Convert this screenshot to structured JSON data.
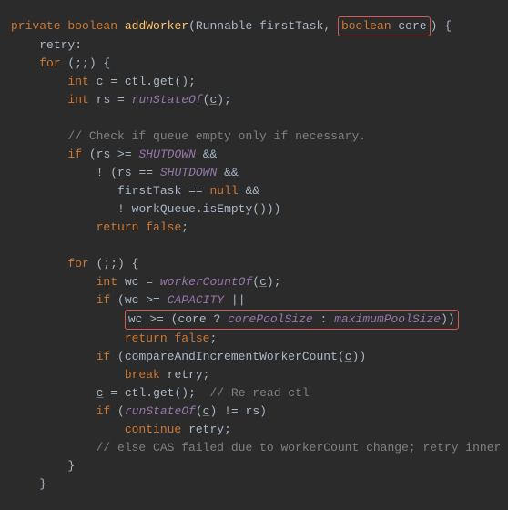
{
  "sig": {
    "private": "private",
    "boolean": "boolean",
    "name": "addWorker",
    "p1_type": "Runnable",
    "p1_name": "firstTask",
    "p2_type": "boolean",
    "p2_name": "core",
    "brace": " {"
  },
  "labels": {
    "retry": "retry:"
  },
  "kw": {
    "for": "for",
    "int": "int",
    "if": "if",
    "return": "return",
    "false": "false",
    "null": "null",
    "break": "break",
    "continue": "continue"
  },
  "vars": {
    "c": "c",
    "rs": "rs",
    "wc": "wc",
    "ctl": "ctl",
    "workQueue": "workQueue",
    "firstTask": "firstTask",
    "core": "core",
    "retry": "retry"
  },
  "calls": {
    "get": "get",
    "runStateOf": "runStateOf",
    "isEmpty": "isEmpty",
    "workerCountOf": "workerCountOf",
    "compareAndIncrementWorkerCount": "compareAndIncrementWorkerCount"
  },
  "consts": {
    "SHUTDOWN": "SHUTDOWN",
    "CAPACITY": "CAPACITY",
    "corePoolSize": "corePoolSize",
    "maximumPoolSize": "maximumPoolSize"
  },
  "comments": {
    "c1": "// Check if queue empty only if necessary.",
    "c2": "// Re-read ctl",
    "c3": "// else CAS failed due to workerCount change; retry inner loop"
  },
  "misc": {
    "for_hdr": " (;;) {",
    "amp": " &&",
    "eq": " = ",
    "geq": " >= ",
    "eqeq": " == ",
    "neq": " != ",
    "or": " ||",
    "q": " ? ",
    "colon": " : ",
    "dot": ".",
    "open": "(",
    "close": ")",
    "semi": ";",
    "bang": "! ",
    "bang2": "!",
    "cparen3": "()))",
    "cparen2": "()",
    "cparen1_semi": "();",
    "wc_ge": "wc >= (",
    "close2": "))",
    "rbrace": "}"
  }
}
